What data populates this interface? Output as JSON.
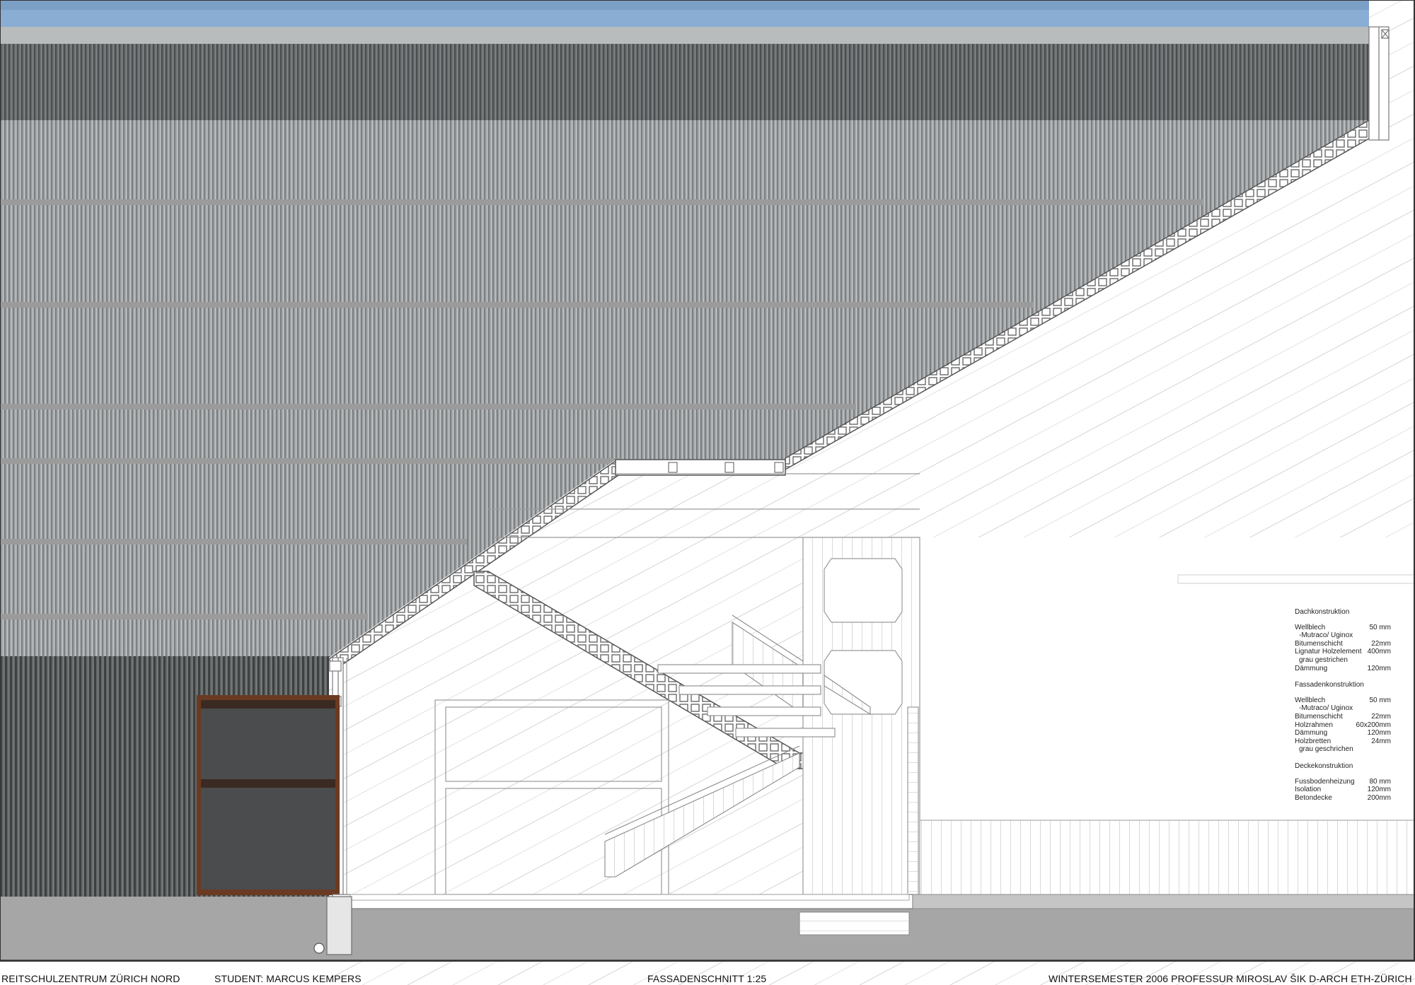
{
  "drawing": {
    "title": "FASSADENSCHNITT 1:25"
  },
  "footer": {
    "project": "REITSCHULZENTRUM ZÜRICH NORD",
    "student": "STUDENT: MARCUS KEMPERS",
    "title": "FASSADENSCHNITT 1:25",
    "institution": "WINTERSEMESTER 2006  PROFESSUR MIROSLAV ŠIK D-ARCH ETH-ZÜRICH"
  },
  "specs": [
    {
      "heading": "Dachkonstruktion",
      "rows": [
        {
          "label": "Wellblech",
          "value": "50 mm"
        },
        {
          "label": " -Mutraco/ Uginox",
          "value": ""
        },
        {
          "label": "Bitumenschicht",
          "value": "22mm"
        },
        {
          "label": "Lignatur Holzelement",
          "value": "400mm"
        },
        {
          "label": "  grau gestrichen",
          "value": ""
        },
        {
          "label": "Dämmung",
          "value": "120mm"
        }
      ]
    },
    {
      "heading": "Fassadenkonstruktion",
      "rows": [
        {
          "label": "Wellblech",
          "value": "50 mm"
        },
        {
          "label": " -Mutraco/ Uginox",
          "value": ""
        },
        {
          "label": "Bitumenschicht",
          "value": "22mm"
        },
        {
          "label": "Holzrahmen",
          "value": "60x200mm"
        },
        {
          "label": "Dämmung",
          "value": "120mm"
        },
        {
          "label": "Holzbretten",
          "value": "24mm"
        },
        {
          "label": "  grau geschrichen",
          "value": ""
        }
      ]
    },
    {
      "heading": "Deckekonstruktion",
      "rows": [
        {
          "label": "Fussbodenheizung",
          "value": "80 mm"
        },
        {
          "label": "Isolation",
          "value": "120mm"
        },
        {
          "label": "Betondecke",
          "value": "200mm"
        }
      ]
    }
  ],
  "colors": {
    "sky": "#8aaed3",
    "cladding": "#9a9da0",
    "cladding_dark": "#5e6162",
    "ground": "#a6a6a6",
    "window_frame": "#6b3a22"
  }
}
